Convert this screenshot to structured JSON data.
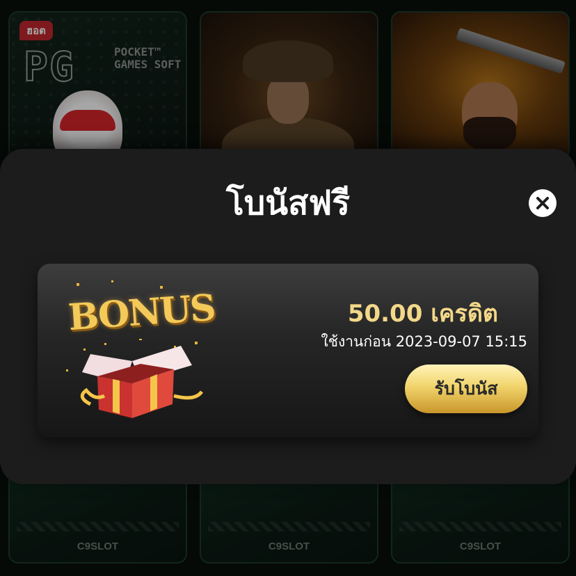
{
  "background": {
    "badge_hot": "ฮอต",
    "pg_logo": {
      "letters": "PG",
      "subtitle": "POCKET™ GAMES SOFT"
    },
    "brand_watermark": "C9SLOT"
  },
  "modal": {
    "title": "โบนัสฟรี",
    "close_icon": "close-icon"
  },
  "bonus": {
    "art_word": "BONUS",
    "amount": "50.00 เครดิต",
    "expiry": "ใช้งานก่อน 2023-09-07 15:15",
    "claim_label": "รับโบนัส"
  },
  "colors": {
    "accent_gold": "#f3d889",
    "modal_bg": "#1c1c1c",
    "button_gold": "#f1d46c"
  }
}
